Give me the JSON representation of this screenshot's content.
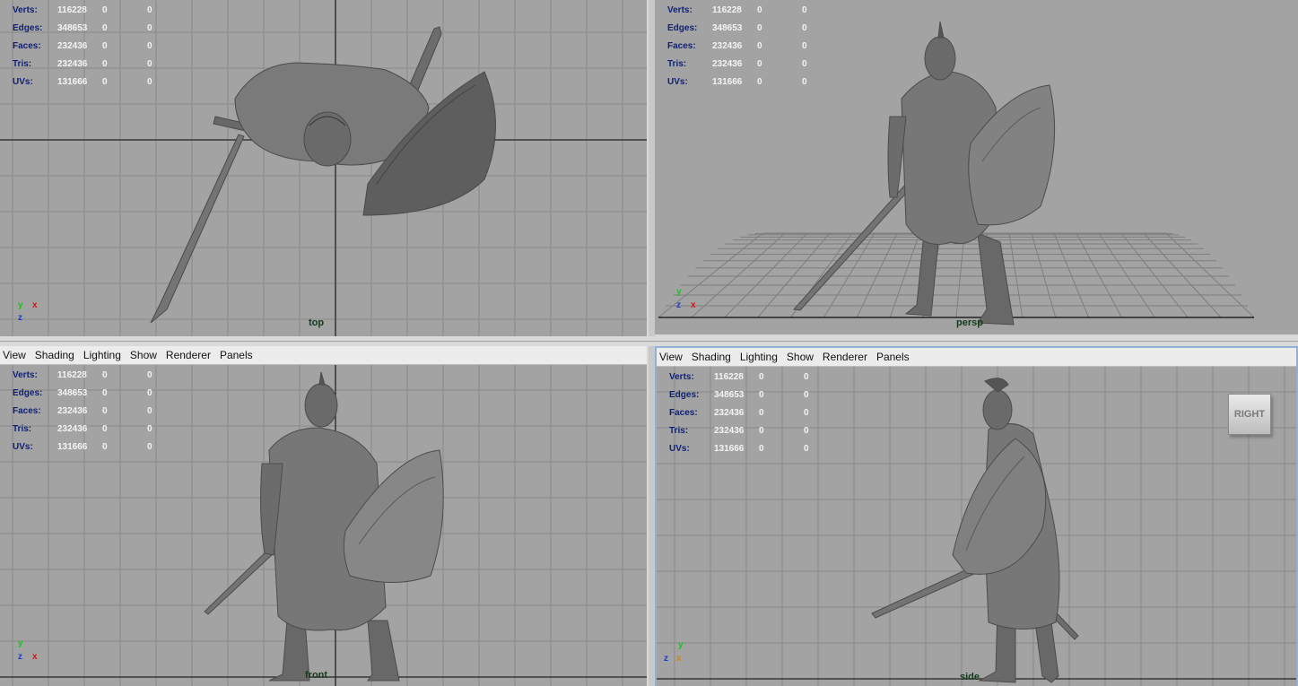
{
  "menu": [
    "View",
    "Shading",
    "Lighting",
    "Show",
    "Renderer",
    "Panels"
  ],
  "hud": {
    "rows": [
      {
        "label": "Verts:",
        "value": "116228",
        "sel": "0",
        "comp": "0"
      },
      {
        "label": "Edges:",
        "value": "348653",
        "sel": "0",
        "comp": "0"
      },
      {
        "label": "Faces:",
        "value": "232436",
        "sel": "0",
        "comp": "0"
      },
      {
        "label": "Tris:",
        "value": "232436",
        "sel": "0",
        "comp": "0"
      },
      {
        "label": "UVs:",
        "value": "131666",
        "sel": "0",
        "comp": "0"
      }
    ]
  },
  "views": {
    "top": "top",
    "persp": "persp",
    "front": "front",
    "side": "side"
  },
  "viewcube": "RIGHT",
  "axes": {
    "x": "x",
    "y": "y",
    "z": "z"
  },
  "colors": {
    "viewport_bg": "#a3a3a3",
    "grid": "#8a8a8a",
    "model": "#6b6b6b",
    "hud_label": "#0f1f76",
    "hud_value": "#f4f4f4",
    "cam_label": "#153a1d",
    "active_border": "#8fb1d6"
  }
}
